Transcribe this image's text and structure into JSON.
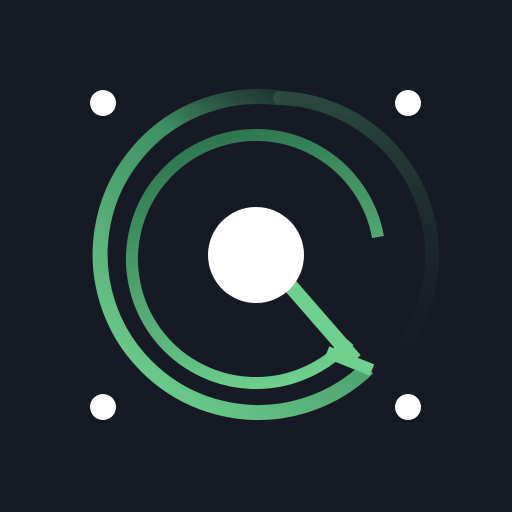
{
  "app": {
    "icon": "radar-scan-icon"
  },
  "colors": {
    "background": "#161a24",
    "accent_light": "#6fcf8e",
    "accent_mid": "#3f9f68",
    "accent_dark": "#2a6b4a",
    "dot": "#ffffff"
  },
  "marks": {
    "corner_dots": [
      "corner-dot-top-left",
      "corner-dot-top-right",
      "corner-dot-bottom-left",
      "corner-dot-bottom-right"
    ],
    "center": "center-dot",
    "pointer": "pointer-line"
  }
}
